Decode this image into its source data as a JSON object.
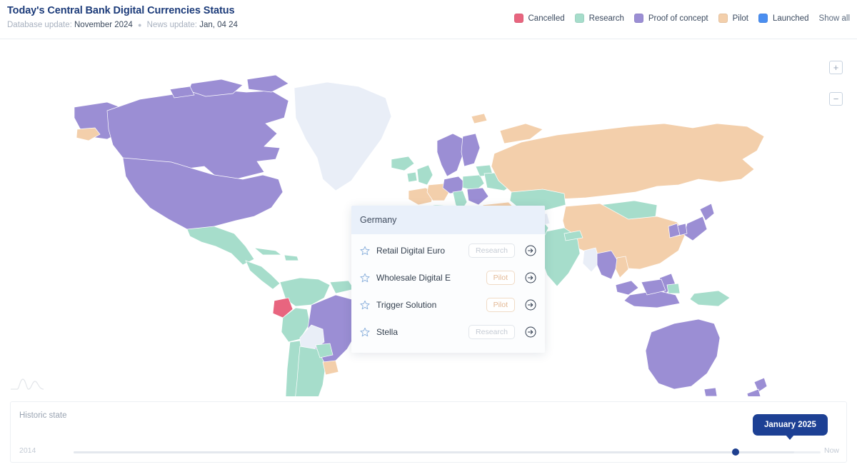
{
  "header": {
    "title": "Today's Central Bank Digital Currencies Status",
    "database_update_label": "Database update:",
    "database_update_value": "November 2024",
    "separator": "●",
    "news_update_label": "News update:",
    "news_update_value": "Jan, 04 24"
  },
  "legend": {
    "show_all_label": "Show all",
    "items": [
      {
        "label": "Cancelled",
        "color": "#e8657f"
      },
      {
        "label": "Research",
        "color": "#a6ddcb"
      },
      {
        "label": "Proof of concept",
        "color": "#9b8ed4"
      },
      {
        "label": "Pilot",
        "color": "#f3cfab"
      },
      {
        "label": "Launched",
        "color": "#4a8ef0"
      }
    ]
  },
  "map": {
    "zoom_in_label": "+",
    "zoom_out_label": "−",
    "background_color": "#ffffff",
    "no_data_color": "#edf0f7",
    "status_colors": {
      "cancelled": "#e8657f",
      "research": "#a6ddcb",
      "proof_of_concept": "#9b8ed4",
      "pilot": "#f3cfab",
      "launched": "#4a8ef0",
      "none": "#eceff7"
    }
  },
  "country_card": {
    "country": "Germany",
    "rows": [
      {
        "name": "Retail Digital Euro",
        "status": "Research",
        "status_key": "research"
      },
      {
        "name": "Wholesale Digital E",
        "status": "Pilot",
        "status_key": "pilot"
      },
      {
        "name": "Trigger Solution",
        "status": "Pilot",
        "status_key": "pilot"
      },
      {
        "name": "Stella",
        "status": "Research",
        "status_key": "research"
      }
    ]
  },
  "timeline": {
    "label": "Historic state",
    "start_year": "2014",
    "end_label": "Now",
    "selected_value": "January 2025",
    "handle_percent": 96.5
  }
}
